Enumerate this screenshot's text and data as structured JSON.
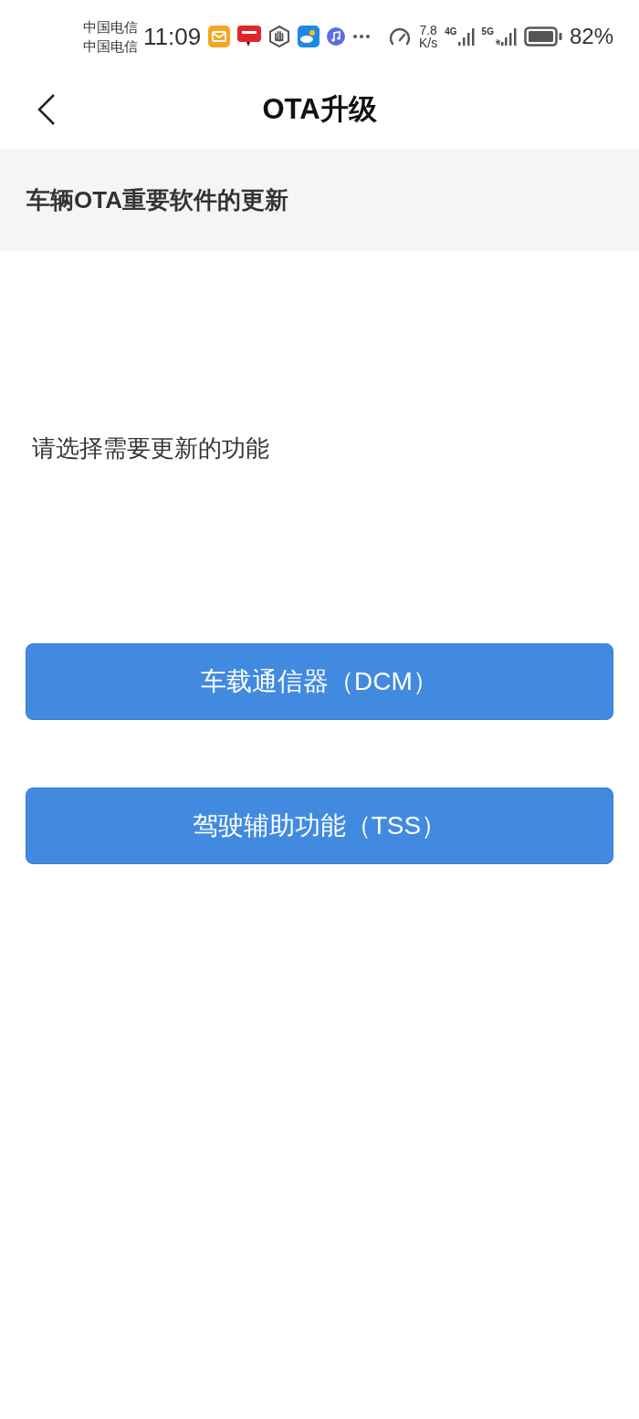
{
  "status_bar": {
    "carriers": [
      "中国电信",
      "中国电信"
    ],
    "time": "11:09",
    "speed": [
      "7.8",
      "K/s"
    ],
    "network_1": "4G",
    "network_2": "5G",
    "battery": "82%"
  },
  "header": {
    "title": "OTA升级"
  },
  "section": {
    "title": "车辆OTA重要软件的更新"
  },
  "prompt": "请选择需要更新的功能",
  "buttons": [
    {
      "label": "车载通信器（DCM）"
    },
    {
      "label": "驾驶辅助功能（TSS）"
    }
  ]
}
